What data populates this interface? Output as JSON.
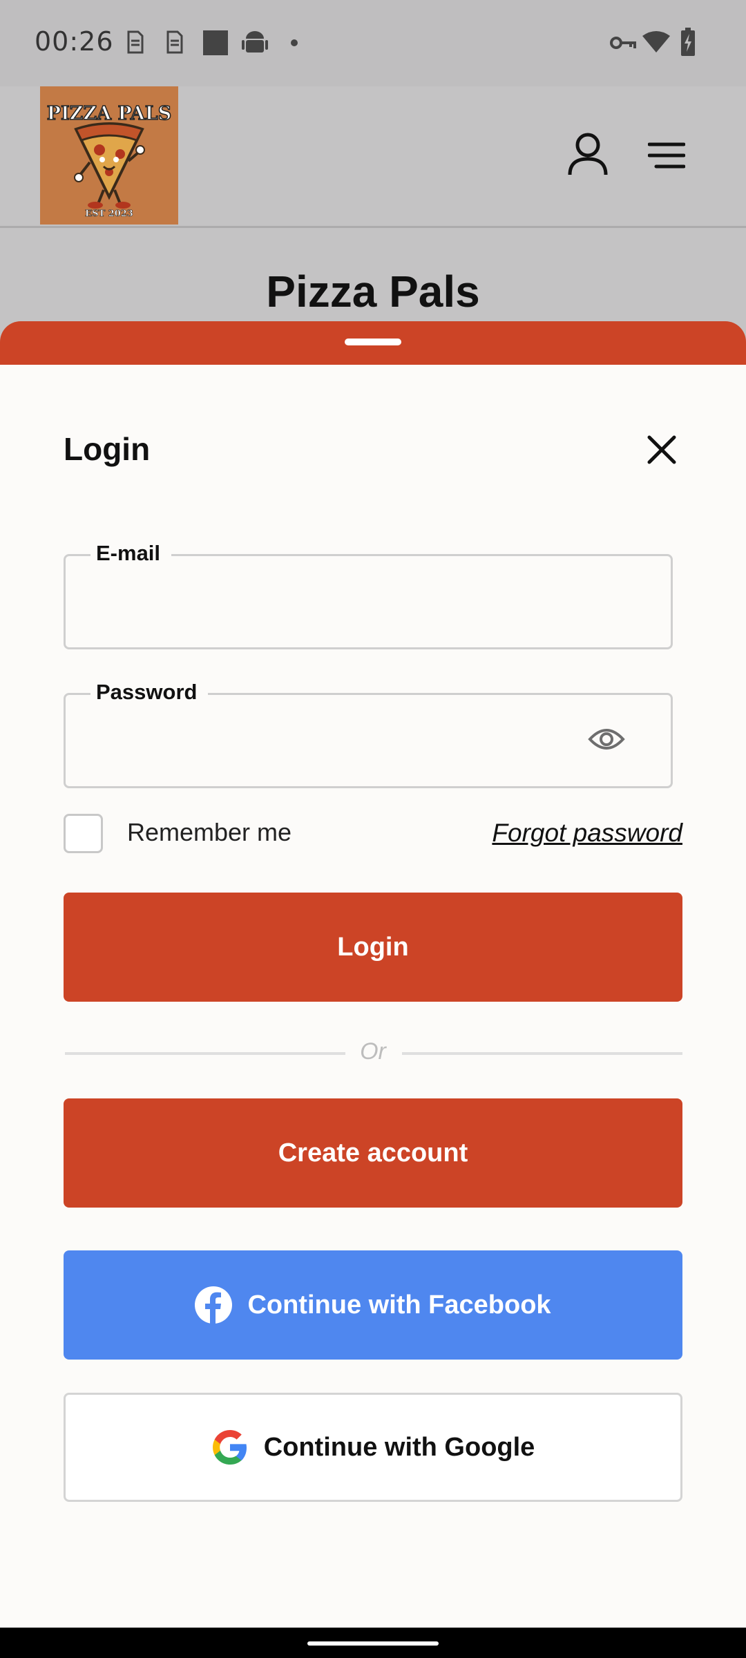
{
  "status_bar": {
    "time": "00:26",
    "icons": [
      "sim-card-icon",
      "sim-card-icon",
      "square-app-icon",
      "android-icon",
      "dot-icon",
      "vpn-key-icon",
      "wifi-icon",
      "battery-charging-icon"
    ]
  },
  "header": {
    "logo": {
      "title_text": "PIZZA PALS",
      "subtitle_text": "EST 2023"
    },
    "account_icon": "person-icon",
    "menu_icon": "hamburger-menu-icon"
  },
  "page": {
    "title": "Pizza Pals"
  },
  "login_sheet": {
    "title": "Login",
    "close_icon": "close-icon",
    "email": {
      "label": "E-mail",
      "value": "",
      "placeholder": ""
    },
    "password": {
      "label": "Password",
      "value": "",
      "placeholder": "",
      "visibility_icon": "eye-icon"
    },
    "remember_me": {
      "label": "Remember me",
      "checked": false
    },
    "forgot_password": "Forgot password",
    "login_button": "Login",
    "divider_text": "Or",
    "create_account_button": "Create account",
    "facebook_button": "Continue with Facebook",
    "google_button": "Continue with Google"
  },
  "colors": {
    "brand_red": "#cc4426",
    "facebook_blue": "#4f87ef",
    "scrim": "#c4c3c4",
    "sheet_bg": "#fcfbf9"
  }
}
